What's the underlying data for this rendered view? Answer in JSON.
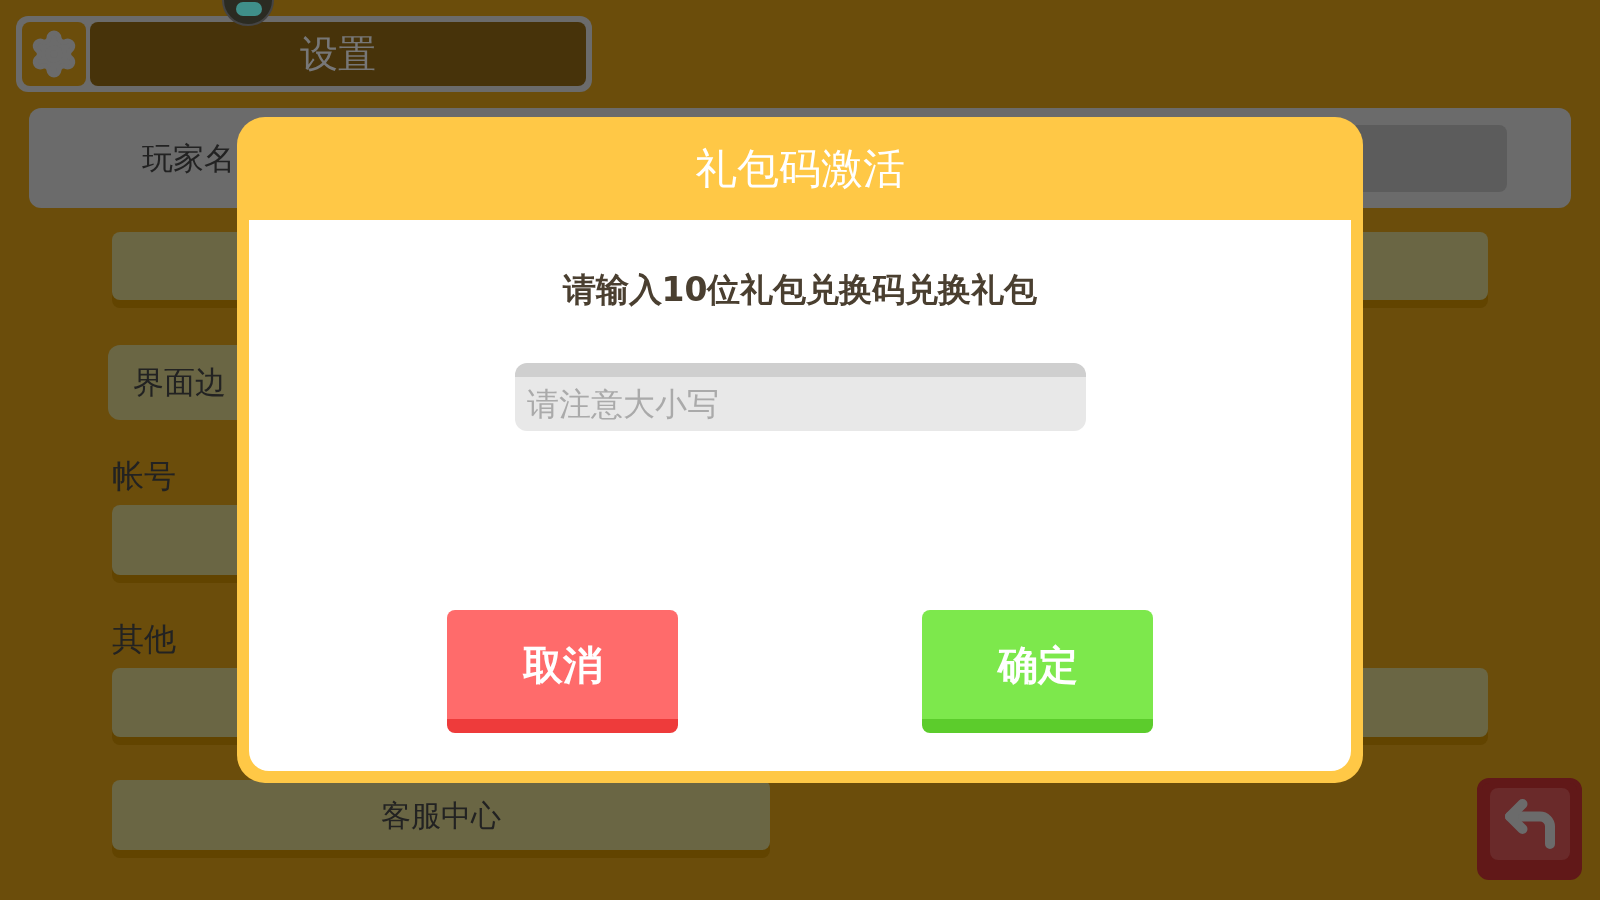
{
  "header": {
    "title": "设置"
  },
  "settings": {
    "player_name_label": "玩家名",
    "interface_margin_label": "界面边",
    "account_section": "帐号",
    "other_section": "其他",
    "service_button": "客服中心"
  },
  "dialog": {
    "title": "礼包码激活",
    "prompt": "请输入10位礼包兑换码兑换礼包",
    "code_field": {
      "placeholder": "请注意大小写"
    },
    "buttons": [
      {
        "label": "取消",
        "kind": "cancel"
      },
      {
        "label": "确定",
        "kind": "confirm"
      }
    ]
  }
}
